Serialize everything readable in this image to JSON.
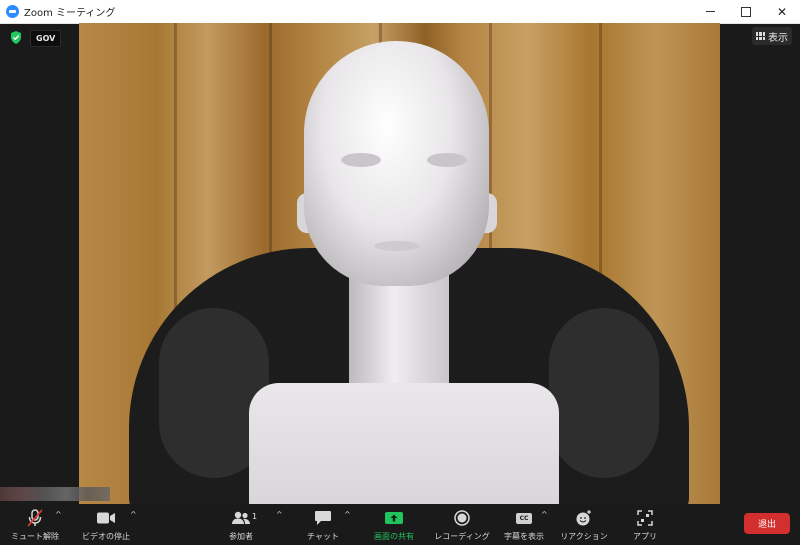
{
  "window": {
    "title": "Zoom ミーティング",
    "controls": {
      "minimize": "minimize",
      "maximize": "maximize",
      "close": "✕"
    }
  },
  "meeting": {
    "security_badge": "GOV",
    "view_button_label": "表示"
  },
  "toolbar": {
    "mute_label": "ミュート解除",
    "video_label": "ビデオの停止",
    "participants_label": "参加者",
    "participants_count": "1",
    "chat_label": "チャット",
    "share_label": "画面の共有",
    "record_label": "レコーディング",
    "captions_label": "字幕を表示",
    "captions_icon_text": "CC",
    "reactions_label": "リアクション",
    "apps_label": "アプリ",
    "leave_label": "退出"
  },
  "colors": {
    "accent": "#2d8cff",
    "share_green": "#21c45d",
    "leave_red": "#d32f2f",
    "security_green": "#22c55e",
    "mute_slash": "#e53935"
  }
}
